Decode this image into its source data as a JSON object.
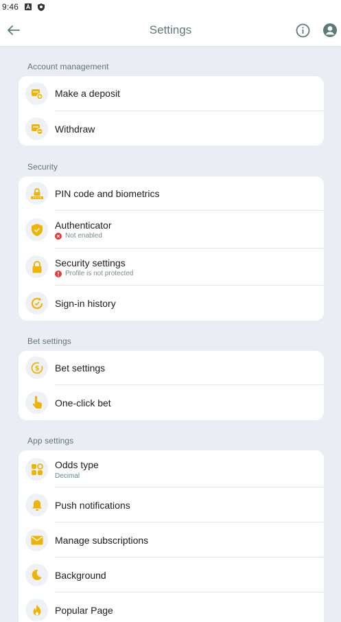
{
  "status_bar": {
    "time": "9:46"
  },
  "header": {
    "title": "Settings"
  },
  "colors": {
    "accent": "#f0b400",
    "header_title": "#5b7a78",
    "error": "#e53935",
    "background": "#eaedf3"
  },
  "sections": {
    "account": {
      "title": "Account management",
      "items": [
        {
          "label": "Make a deposit",
          "icon": "wallet-plus-icon"
        },
        {
          "label": "Withdraw",
          "icon": "wallet-minus-icon"
        }
      ]
    },
    "security": {
      "title": "Security",
      "items": [
        {
          "label": "PIN code and biometrics",
          "icon": "pin-lock-icon"
        },
        {
          "label": "Authenticator",
          "sub": "Not enabled",
          "icon": "shield-check-icon",
          "sub_icon": "error-x-icon"
        },
        {
          "label": "Security settings",
          "sub": "Profile is not protected",
          "icon": "lock-icon",
          "sub_icon": "warning-icon"
        },
        {
          "label": "Sign-in history",
          "icon": "history-icon"
        }
      ]
    },
    "bet": {
      "title": "Bet settings",
      "items": [
        {
          "label": "Bet settings",
          "icon": "coin-cycle-icon"
        },
        {
          "label": "One-click bet",
          "icon": "tap-hand-icon"
        }
      ]
    },
    "app": {
      "title": "App settings",
      "items": [
        {
          "label": "Odds type",
          "sub": "Decimal",
          "icon": "grid-icon"
        },
        {
          "label": "Push notifications",
          "icon": "bell-icon"
        },
        {
          "label": "Manage subscriptions",
          "icon": "envelope-icon"
        },
        {
          "label": "Background",
          "icon": "moon-icon"
        },
        {
          "label": "Popular Page",
          "icon": "flame-icon"
        }
      ]
    }
  }
}
